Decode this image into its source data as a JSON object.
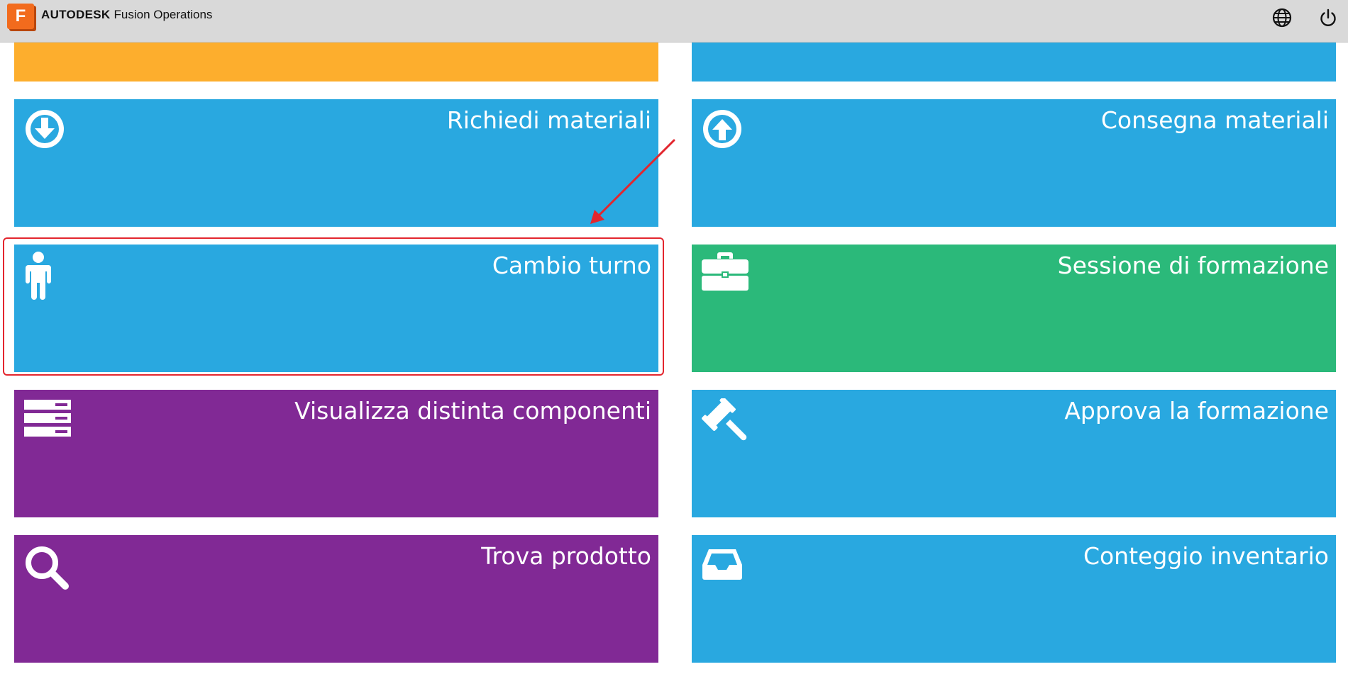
{
  "app": {
    "logo_letter": "F",
    "brand_name": "AUTODESK",
    "product_name": "Fusion Operations"
  },
  "header": {
    "language_icon": "globe-icon",
    "logout_icon": "power-icon"
  },
  "tiles": [
    {
      "label": "",
      "color": "#fdae2d",
      "icon": ""
    },
    {
      "label": "",
      "color": "#29a8e0",
      "icon": ""
    },
    {
      "label": "Richiedi materiali",
      "color": "#29a8e0",
      "icon": "arrow-down-circle-icon"
    },
    {
      "label": "Consegna materiali",
      "color": "#29a8e0",
      "icon": "arrow-up-circle-icon"
    },
    {
      "label": "Cambio turno",
      "color": "#29a8e0",
      "icon": "person-icon"
    },
    {
      "label": "Sessione di formazione",
      "color": "#2bb97a",
      "icon": "briefcase-icon"
    },
    {
      "label": "Visualizza distinta componenti",
      "color": "#812995",
      "icon": "server-list-icon"
    },
    {
      "label": "Approva la formazione",
      "color": "#29a8e0",
      "icon": "gavel-icon"
    },
    {
      "label": "Trova prodotto",
      "color": "#812995",
      "icon": "search-icon"
    },
    {
      "label": "Conteggio inventario",
      "color": "#29a8e0",
      "icon": "inbox-tray-icon"
    }
  ],
  "annotation": {
    "highlight_color": "#e3262e"
  }
}
